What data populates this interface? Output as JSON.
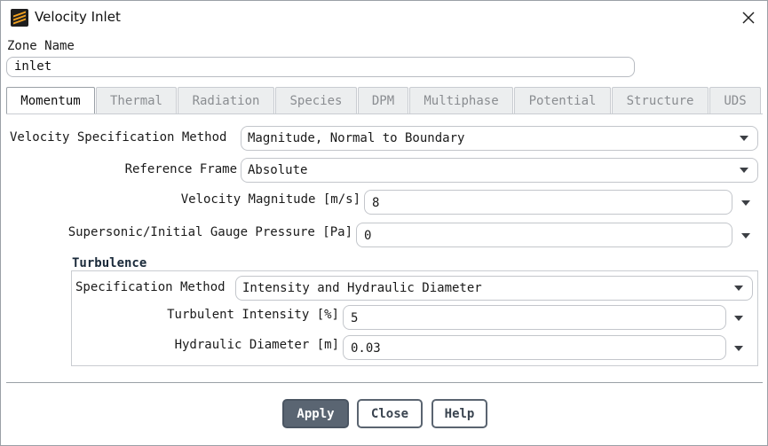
{
  "window": {
    "title": "Velocity Inlet",
    "app_icon": "fluent-app-icon",
    "close_icon": "close-icon"
  },
  "zone": {
    "label": "Zone Name",
    "value": "inlet"
  },
  "tabs": [
    {
      "label": "Momentum",
      "active": true
    },
    {
      "label": "Thermal",
      "active": false
    },
    {
      "label": "Radiation",
      "active": false
    },
    {
      "label": "Species",
      "active": false
    },
    {
      "label": "DPM",
      "active": false
    },
    {
      "label": "Multiphase",
      "active": false
    },
    {
      "label": "Potential",
      "active": false
    },
    {
      "label": "Structure",
      "active": false
    },
    {
      "label": "UDS",
      "active": false
    }
  ],
  "momentum": {
    "velocity_spec": {
      "label": "Velocity Specification Method",
      "value": "Magnitude, Normal to Boundary"
    },
    "reference_frame": {
      "label": "Reference Frame",
      "value": "Absolute"
    },
    "velocity_magnitude": {
      "label": "Velocity Magnitude [m/s]",
      "value": "8"
    },
    "gauge_pressure": {
      "label": "Supersonic/Initial Gauge Pressure [Pa]",
      "value": "0"
    }
  },
  "turbulence": {
    "title": "Turbulence",
    "spec_method": {
      "label": "Specification Method",
      "value": "Intensity and Hydraulic Diameter"
    },
    "intensity": {
      "label": "Turbulent Intensity [%]",
      "value": "5"
    },
    "hydraulic_diameter": {
      "label": "Hydraulic Diameter [m]",
      "value": "0.03"
    }
  },
  "buttons": {
    "apply": "Apply",
    "close": "Close",
    "help": "Help"
  },
  "colors": {
    "primary_button": "#5a6572",
    "border": "#c3c6cb",
    "inactive_tab_text": "#8a8d91"
  }
}
